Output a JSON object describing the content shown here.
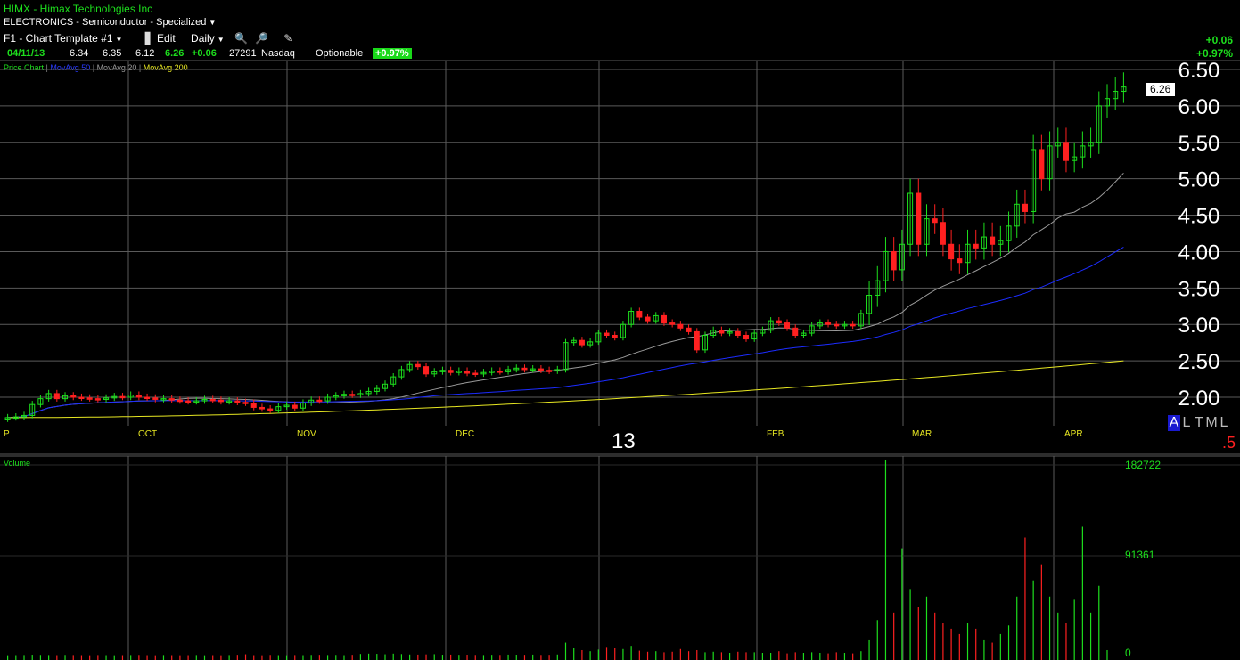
{
  "header": {
    "symbol_line": "HIMX - Himax Technologies Inc",
    "sector_line": "ELECTRONICS - Semiconductor - Specialized",
    "template_label": "F1 - Chart Template #1",
    "edit_label": "Edit",
    "period_label": "Daily"
  },
  "quote": {
    "date": "04/11/13",
    "open": "6.34",
    "high": "6.35",
    "low": "6.12",
    "last": "6.26",
    "change": "+0.06",
    "volume": "27291",
    "exchange": "Nasdaq",
    "optionable": "Optionable",
    "pct_change": "+0.97%"
  },
  "right_change": {
    "abs": "+0.06",
    "pct": "+0.97%"
  },
  "legend": {
    "price_chart": "Price Chart",
    "ma50": "MovAvg 50",
    "ma20": "MovAvg 20",
    "ma200": "MovAvg 200"
  },
  "price_box": "6.26",
  "year_label": "13",
  "timeframes": [
    "A",
    "L",
    "T",
    "M",
    "L"
  ],
  "corner_value": ".5",
  "volume_label": "Volume",
  "colors": {
    "up": "#1ddf1d",
    "down": "#ff2020",
    "ma20": "#9a9a9a",
    "ma50": "#1c2cff",
    "ma200": "#e7e722",
    "grid": "#5a5a5a",
    "month_label": "#e7e722"
  },
  "chart_data": [
    {
      "type": "candlestick",
      "title": "HIMX - Himax Technologies Inc",
      "x_labels": [
        "P",
        "OCT",
        "NOV",
        "DEC",
        "13",
        "FEB",
        "MAR",
        "APR"
      ],
      "y_ticks": [
        "6.50",
        "6.00",
        "5.50",
        "5.00",
        "4.50",
        "4.00",
        "3.50",
        "3.00",
        "2.50",
        "2.00"
      ],
      "ylim": [
        1.75,
        6.6
      ],
      "series": [
        {
          "name": "Price Chart",
          "close": [
            1.72,
            1.73,
            1.75,
            1.9,
            1.98,
            2.05,
            1.98,
            2.02,
            2.0,
            1.99,
            1.98,
            1.97,
            1.99,
            2.01,
            2.0,
            2.03,
            2.0,
            1.99,
            1.97,
            1.98,
            1.96,
            1.95,
            1.94,
            1.95,
            1.97,
            1.96,
            1.94,
            1.95,
            1.93,
            1.92,
            1.86,
            1.84,
            1.82,
            1.87,
            1.89,
            1.85,
            1.92,
            1.96,
            1.95,
            2.0,
            2.02,
            2.04,
            2.03,
            2.05,
            2.08,
            2.12,
            2.18,
            2.28,
            2.38,
            2.45,
            2.42,
            2.32,
            2.35,
            2.37,
            2.34,
            2.36,
            2.33,
            2.32,
            2.34,
            2.36,
            2.35,
            2.38,
            2.4,
            2.38,
            2.39,
            2.37,
            2.36,
            2.38,
            2.75,
            2.78,
            2.72,
            2.76,
            2.88,
            2.85,
            2.82,
            3.0,
            3.18,
            3.1,
            3.05,
            3.12,
            3.02,
            3.0,
            2.95,
            2.9,
            2.65,
            2.85,
            2.92,
            2.88,
            2.9,
            2.85,
            2.8,
            2.88,
            2.92,
            3.05,
            3.02,
            2.95,
            2.85,
            2.88,
            2.98,
            3.02,
            3.0,
            2.98,
            3.0,
            2.98,
            3.15,
            3.4,
            3.6,
            4.0,
            3.75,
            4.1,
            4.8,
            4.1,
            4.45,
            4.4,
            4.1,
            3.9,
            3.85,
            4.1,
            4.05,
            4.2,
            4.1,
            4.15,
            4.35,
            4.65,
            4.55,
            5.4,
            5.0,
            5.45,
            5.5,
            5.25,
            5.3,
            5.45,
            5.5,
            6.0,
            6.1,
            6.2,
            6.26
          ],
          "up_down": "green = up day, red = down day"
        },
        {
          "name": "MovAvg 20",
          "color": "gray"
        },
        {
          "name": "MovAvg 50",
          "color": "blue"
        },
        {
          "name": "MovAvg 200",
          "color": "yellow"
        }
      ]
    },
    {
      "type": "bar",
      "title": "Volume",
      "y_ticks": [
        "182722",
        "91361",
        "0"
      ],
      "ylim": [
        0,
        182722
      ],
      "series": [
        {
          "name": "Volume",
          "values": [
            300,
            400,
            500,
            800,
            600,
            500,
            400,
            600,
            500,
            400,
            300,
            500,
            400,
            300,
            400,
            500,
            600,
            400,
            300,
            500,
            400,
            300,
            400,
            500,
            300,
            400,
            300,
            500,
            700,
            1200,
            400,
            300,
            600,
            400,
            300,
            500,
            400,
            600,
            700,
            500,
            600,
            400,
            700,
            1500,
            1800,
            1600,
            1200,
            1800,
            1400,
            1000,
            900,
            1100,
            1300,
            800,
            900,
            700,
            800,
            600,
            500,
            700,
            600,
            900,
            800,
            700,
            900,
            600,
            700,
            1000,
            12000,
            7000,
            5000,
            4000,
            5500,
            8000,
            7000,
            6000,
            9000,
            4500,
            3500,
            4000,
            3000,
            3500,
            6000,
            4000,
            5000,
            3000,
            3500,
            3000,
            2500,
            3500,
            3000,
            3000,
            2500,
            2500,
            4000,
            2000,
            3000,
            2500,
            3000,
            2500,
            2000,
            3000,
            2500,
            2000,
            4000,
            15000,
            33000,
            182722,
            40000,
            100000,
            62000,
            45000,
            55000,
            40000,
            30000,
            25000,
            20000,
            30000,
            25000,
            15000,
            12000,
            20000,
            28000,
            55000,
            110000,
            70000,
            85000,
            55000,
            40000,
            30000,
            52000,
            120000,
            40000,
            65000,
            5000
          ]
        }
      ]
    }
  ]
}
